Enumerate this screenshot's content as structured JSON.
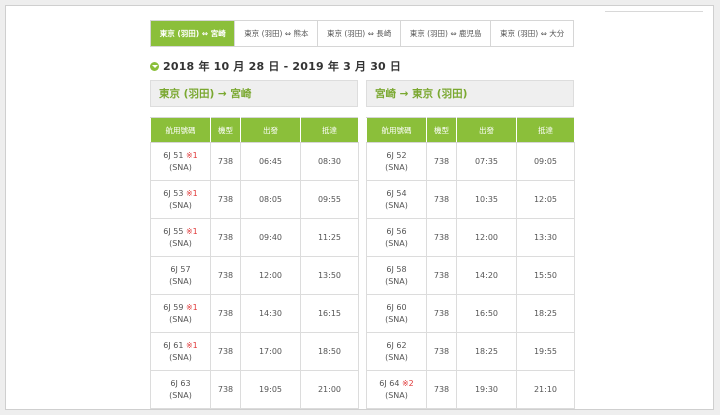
{
  "tabs": [
    {
      "label": "東京 (羽田) ⇔ 宮崎",
      "active": true
    },
    {
      "label": "東京 (羽田) ⇔ 熊本",
      "active": false
    },
    {
      "label": "東京 (羽田) ⇔ 長崎",
      "active": false
    },
    {
      "label": "東京 (羽田) ⇔ 鹿児島",
      "active": false
    },
    {
      "label": "東京 (羽田) ⇔ 大分",
      "active": false
    }
  ],
  "date_range": "2018 年 10 月 28 日 - 2019 年 3 月 30 日",
  "columns": [
    "航用號碼",
    "機型",
    "出發",
    "抵達"
  ],
  "left": {
    "route": "東京 (羽田) → 宮崎",
    "rows": [
      {
        "flight": "6J 51",
        "note": "※1",
        "airport": "(SNA)",
        "aircraft": "738",
        "depart": "06:45",
        "arrive": "08:30"
      },
      {
        "flight": "6J 53",
        "note": "※1",
        "airport": "(SNA)",
        "aircraft": "738",
        "depart": "08:05",
        "arrive": "09:55"
      },
      {
        "flight": "6J 55",
        "note": "※1",
        "airport": "(SNA)",
        "aircraft": "738",
        "depart": "09:40",
        "arrive": "11:25"
      },
      {
        "flight": "6J 57",
        "note": "",
        "airport": "(SNA)",
        "aircraft": "738",
        "depart": "12:00",
        "arrive": "13:50"
      },
      {
        "flight": "6J 59",
        "note": "※1",
        "airport": "(SNA)",
        "aircraft": "738",
        "depart": "14:30",
        "arrive": "16:15"
      },
      {
        "flight": "6J 61",
        "note": "※1",
        "airport": "(SNA)",
        "aircraft": "738",
        "depart": "17:00",
        "arrive": "18:50"
      },
      {
        "flight": "6J 63",
        "note": "",
        "airport": "(SNA)",
        "aircraft": "738",
        "depart": "19:05",
        "arrive": "21:00"
      }
    ]
  },
  "right": {
    "route": "宮崎 → 東京 (羽田)",
    "rows": [
      {
        "flight": "6J 52",
        "note": "",
        "airport": "(SNA)",
        "aircraft": "738",
        "depart": "07:35",
        "arrive": "09:05"
      },
      {
        "flight": "6J 54",
        "note": "",
        "airport": "(SNA)",
        "aircraft": "738",
        "depart": "10:35",
        "arrive": "12:05"
      },
      {
        "flight": "6J 56",
        "note": "",
        "airport": "(SNA)",
        "aircraft": "738",
        "depart": "12:00",
        "arrive": "13:30"
      },
      {
        "flight": "6J 58",
        "note": "",
        "airport": "(SNA)",
        "aircraft": "738",
        "depart": "14:20",
        "arrive": "15:50"
      },
      {
        "flight": "6J 60",
        "note": "",
        "airport": "(SNA)",
        "aircraft": "738",
        "depart": "16:50",
        "arrive": "18:25"
      },
      {
        "flight": "6J 62",
        "note": "",
        "airport": "(SNA)",
        "aircraft": "738",
        "depart": "18:25",
        "arrive": "19:55"
      },
      {
        "flight": "6J 64",
        "note": "※2",
        "airport": "(SNA)",
        "aircraft": "738",
        "depart": "19:30",
        "arrive": "21:10"
      }
    ]
  },
  "colors": {
    "accent": "#8bbf3a",
    "route_text": "#7aa830",
    "note": "#e03a3a"
  }
}
